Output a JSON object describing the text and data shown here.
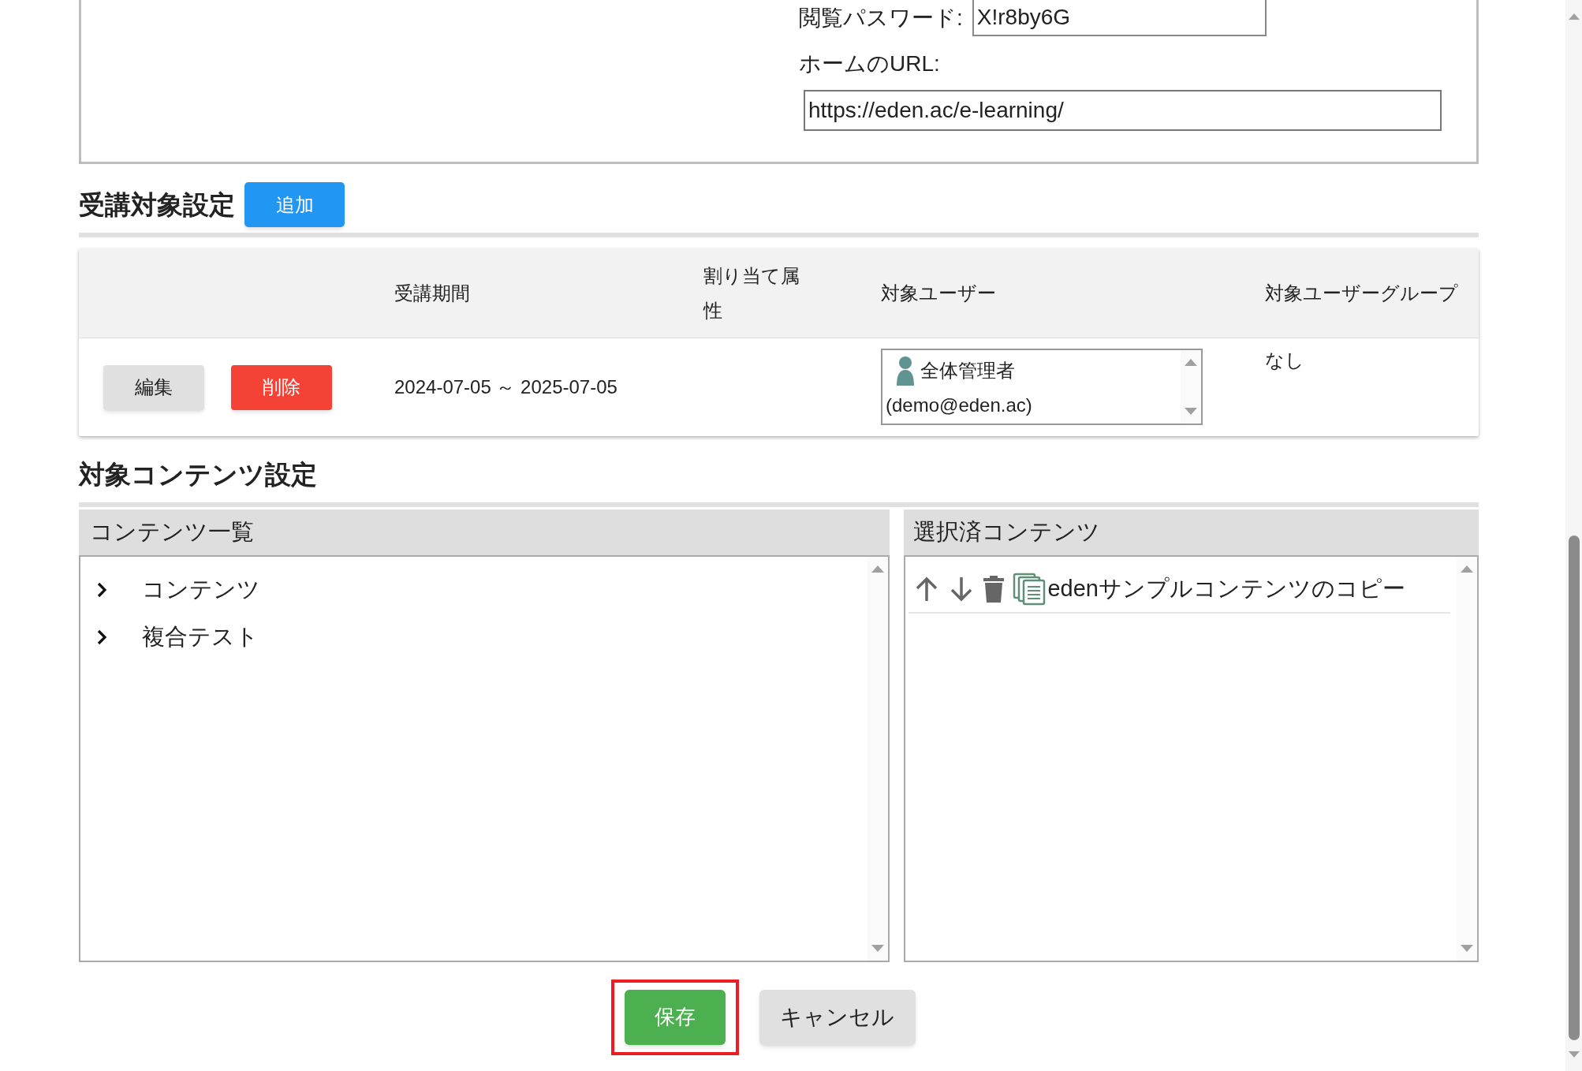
{
  "site_settings": {
    "password_label": "閲覧パスワード:",
    "password_value": "X!r8by6G",
    "home_url_label": "ホームのURL:",
    "home_url_value": "https://eden.ac/e-learning/"
  },
  "target_settings": {
    "title": "受講対象設定",
    "add_button": "追加",
    "columns": [
      "受講期間",
      "割り当て属性",
      "対象ユーザー",
      "対象ユーザーグループ"
    ],
    "rows": [
      {
        "edit_button": "編集",
        "delete_button": "削除",
        "period": "2024-07-05 ～ 2025-07-05",
        "users": [
          {
            "name": "全体管理者",
            "email": "(demo@eden.ac)"
          }
        ],
        "group": "なし"
      }
    ]
  },
  "content_settings": {
    "title": "対象コンテンツ設定",
    "content_list": {
      "title": "コンテンツ一覧",
      "items": [
        {
          "label": "コンテンツ",
          "expanded": false
        },
        {
          "label": "複合テスト",
          "expanded": false
        }
      ]
    },
    "selected_contents": {
      "title": "選択済コンテンツ",
      "items": [
        {
          "label": "edenサンプルコンテンツのコピー"
        }
      ]
    }
  },
  "actions": {
    "save": "保存",
    "cancel": "キャンセル",
    "save_highlighted": true
  }
}
